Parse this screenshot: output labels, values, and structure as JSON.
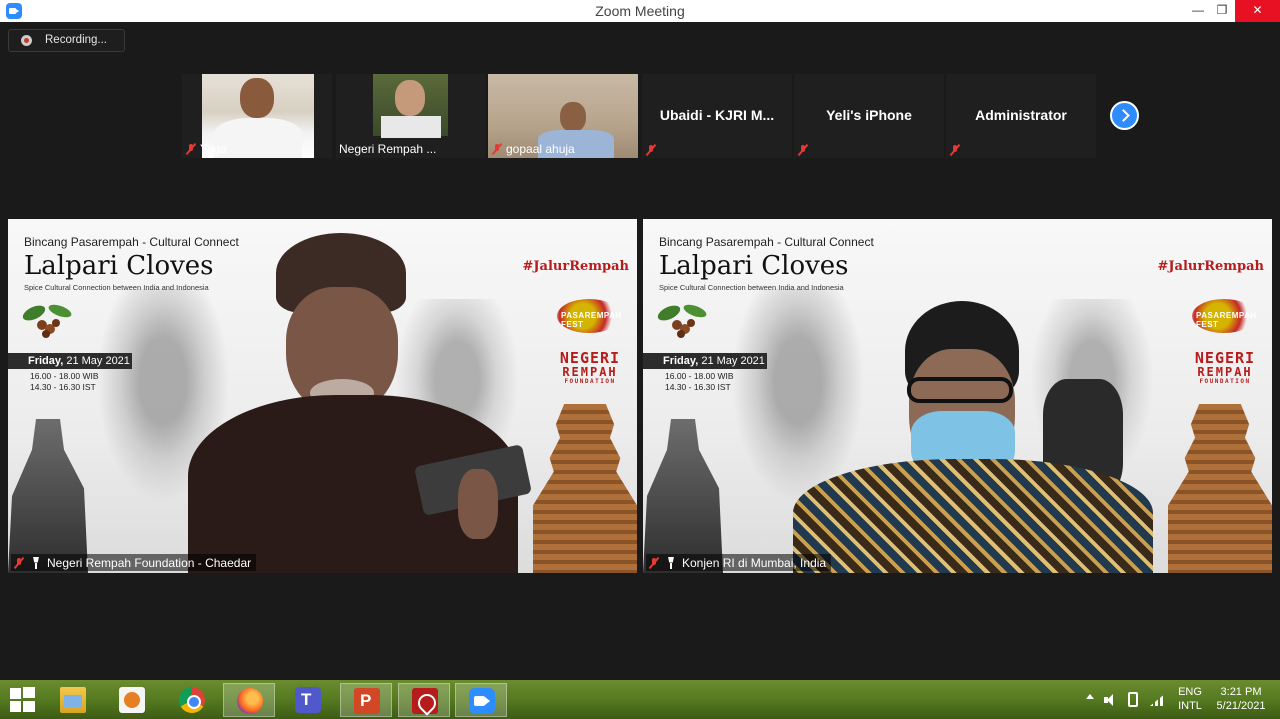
{
  "window": {
    "title": "Zoom Meeting",
    "min": "—",
    "max": "❐",
    "close": "✕"
  },
  "recording": {
    "label": "Recording..."
  },
  "gallery": {
    "tiles": [
      {
        "label": "Yoga",
        "has_video": true
      },
      {
        "label": "Negeri Rempah ...",
        "has_video": true
      },
      {
        "label": "gopaal ahuja",
        "has_video": true
      },
      {
        "name": "Ubaidi - KJRI M...",
        "has_video": false
      },
      {
        "name": "Yeli's iPhone",
        "has_video": false
      },
      {
        "name": "Administrator",
        "has_video": false
      }
    ]
  },
  "slide": {
    "subtitle": "Bincang Pasarempah - Cultural Connect",
    "headline": "Lalpari Cloves",
    "tagline": "Spice Cultural Connection between India and Indonesia",
    "hashtag": "#JalurRempah",
    "fest_logo": "PASAREMPAH FEST",
    "foundation_logo": [
      "NEGERI",
      "REMPAH",
      "FOUNDATION"
    ],
    "date_day": "Friday,",
    "date_rest": " 21 May 2021",
    "time_wib": "16.00 - 18.00 WIB",
    "time_ist": "14.30 - 16.30 IST"
  },
  "videos": {
    "left": {
      "label": "Negeri Rempah Foundation - Chaedar"
    },
    "right": {
      "label": "Konjen RI di Mumbai, India"
    }
  },
  "taskbar": {
    "apps": [
      "windows-explorer",
      "video-player",
      "chrome",
      "firefox",
      "teams",
      "powerpoint",
      "acrobat",
      "zoom"
    ],
    "lang_top": "ENG",
    "lang_bottom": "INTL",
    "time": "3:21 PM",
    "date": "5/21/2021"
  },
  "colors": {
    "zoom_blue": "#2d8cff",
    "mute_red": "#e53935",
    "close_red": "#e81123",
    "brand_red": "#b71c1c"
  }
}
